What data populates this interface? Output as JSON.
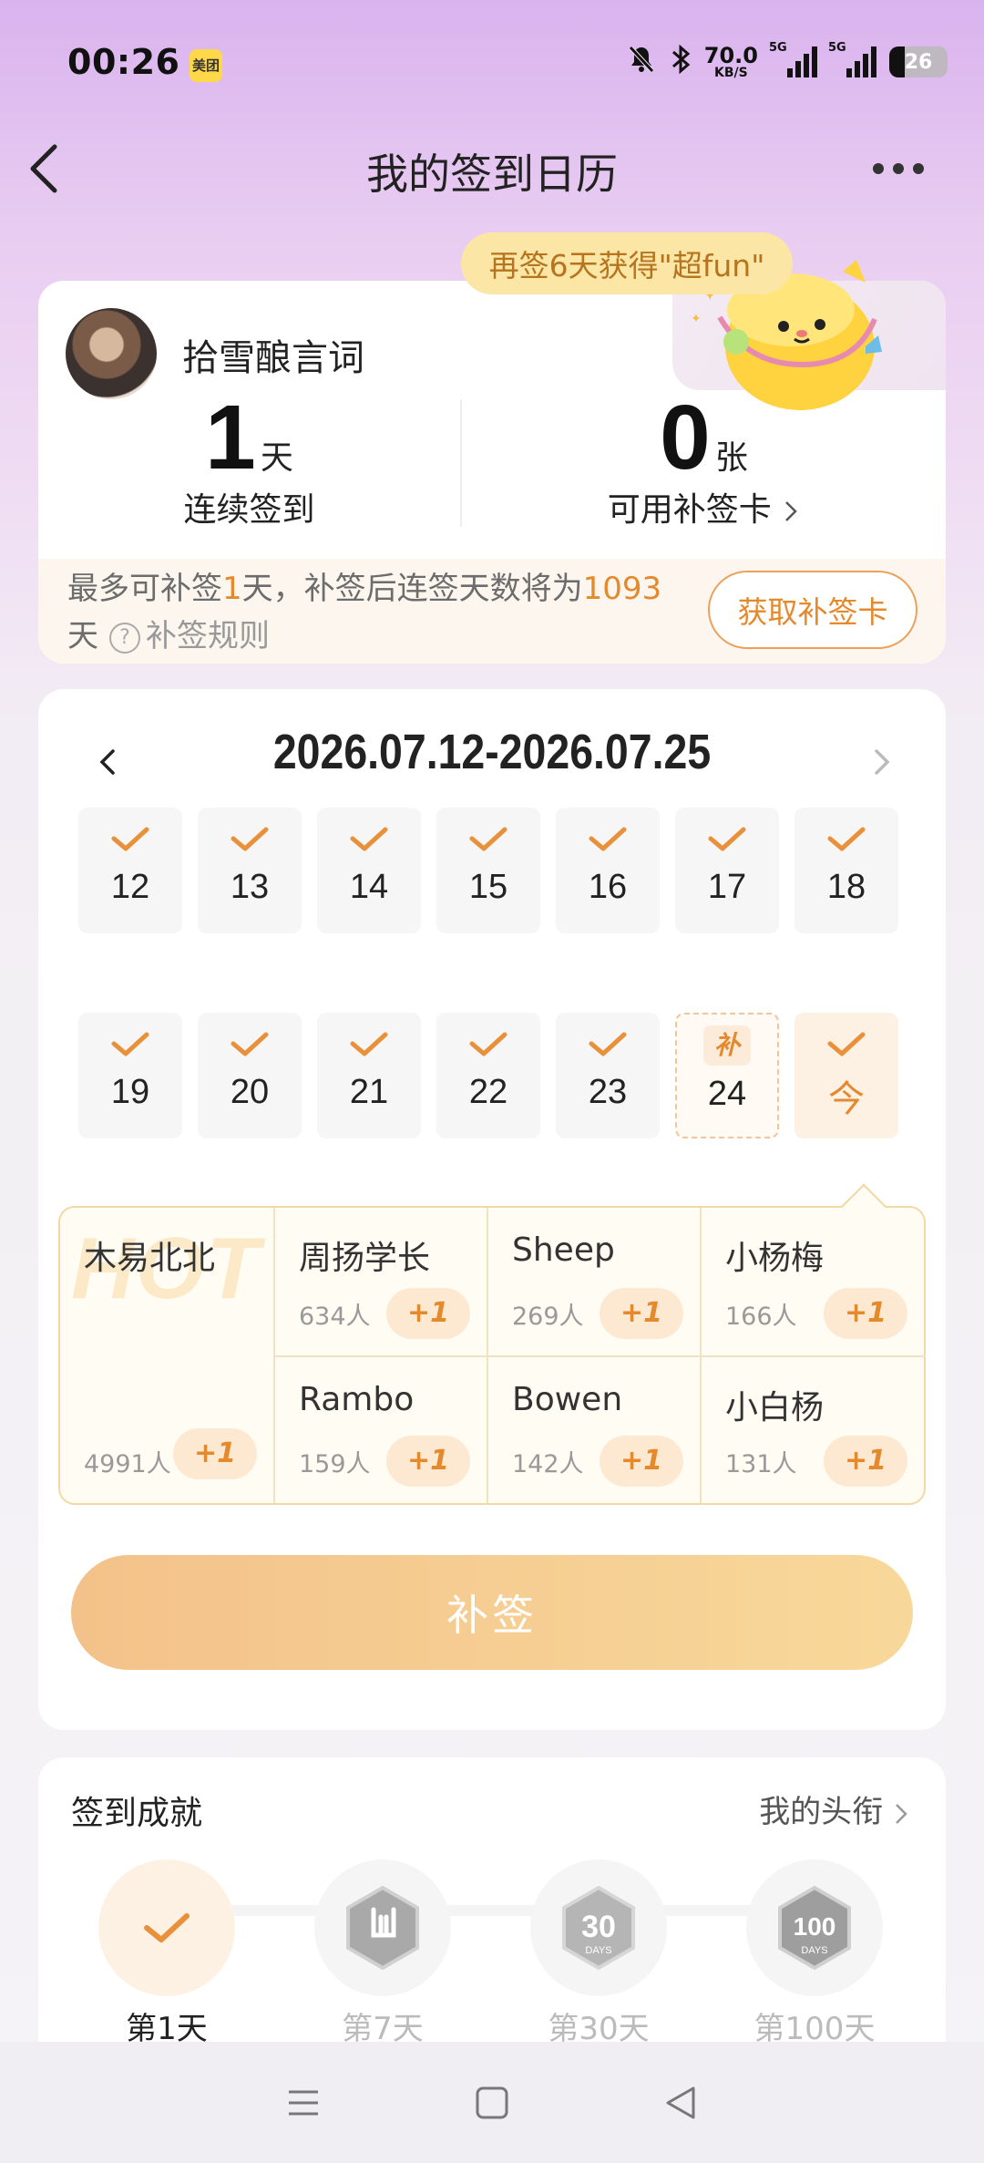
{
  "status_bar": {
    "time": "00:26",
    "app_badge": "美团",
    "net_speed": "70.0",
    "net_unit": "KB/S",
    "signal_1": "5G",
    "signal_2": "5G",
    "battery": "26",
    "battery_level_pct": 26
  },
  "header": {
    "title": "我的签到日历"
  },
  "promo": {
    "bubble_text": "再签6天获得\"超fun\""
  },
  "user": {
    "name": "拾雪酿言词",
    "streak_value": "1",
    "streak_unit": "天",
    "streak_label": "连续签到",
    "cards_value": "0",
    "cards_unit": "张",
    "cards_label": "可用补签卡"
  },
  "makeup_info": {
    "text_pre": "最多可补签",
    "days": "1",
    "text_mid": "天，补签后连签天数将为",
    "result_days": "1093",
    "text_post": "天",
    "rules_link": "补签规则",
    "get_card_button": "获取补签卡"
  },
  "calendar": {
    "range": "2026.07.12-2026.07.25",
    "week1": [
      {
        "day": "12"
      },
      {
        "day": "13"
      },
      {
        "day": "14"
      },
      {
        "day": "15"
      },
      {
        "day": "16"
      },
      {
        "day": "17"
      },
      {
        "day": "18"
      }
    ],
    "week2": [
      {
        "day": "19"
      },
      {
        "day": "20"
      },
      {
        "day": "21"
      },
      {
        "day": "22"
      },
      {
        "day": "23"
      },
      {
        "day": "24",
        "badge": "补"
      },
      {
        "day": "今"
      }
    ]
  },
  "friends": {
    "watermark": "HOT",
    "top": {
      "name": "木易北北",
      "count": "4991人",
      "plus": "+1"
    },
    "others": [
      {
        "name": "周扬学长",
        "count": "634人",
        "plus": "+1"
      },
      {
        "name": "Sheep",
        "count": "269人",
        "plus": "+1"
      },
      {
        "name": "小杨梅",
        "count": "166人",
        "plus": "+1"
      },
      {
        "name": "Rambo",
        "count": "159人",
        "plus": "+1"
      },
      {
        "name": "Bowen",
        "count": "142人",
        "plus": "+1"
      },
      {
        "name": "小白杨",
        "count": "131人",
        "plus": "+1"
      }
    ]
  },
  "makeup_button": "补签",
  "achievements": {
    "title": "签到成就",
    "link": "我的头衔",
    "items": [
      {
        "label": "第1天",
        "badge": "check-icon"
      },
      {
        "label": "第7天",
        "badge": "rock-hand-badge-icon"
      },
      {
        "label": "第30天",
        "badge": "30-days-badge-icon",
        "badge_text": "30",
        "badge_sub": "DAYS"
      },
      {
        "label": "第100天",
        "badge": "100-days-badge-icon",
        "badge_text": "100",
        "badge_sub": "DAYS"
      }
    ]
  },
  "colors": {
    "accent": "#e5892d",
    "button_gradient_start": "#f3c28a",
    "button_gradient_end": "#f8d89a",
    "bubble": "#fbe6a6"
  }
}
